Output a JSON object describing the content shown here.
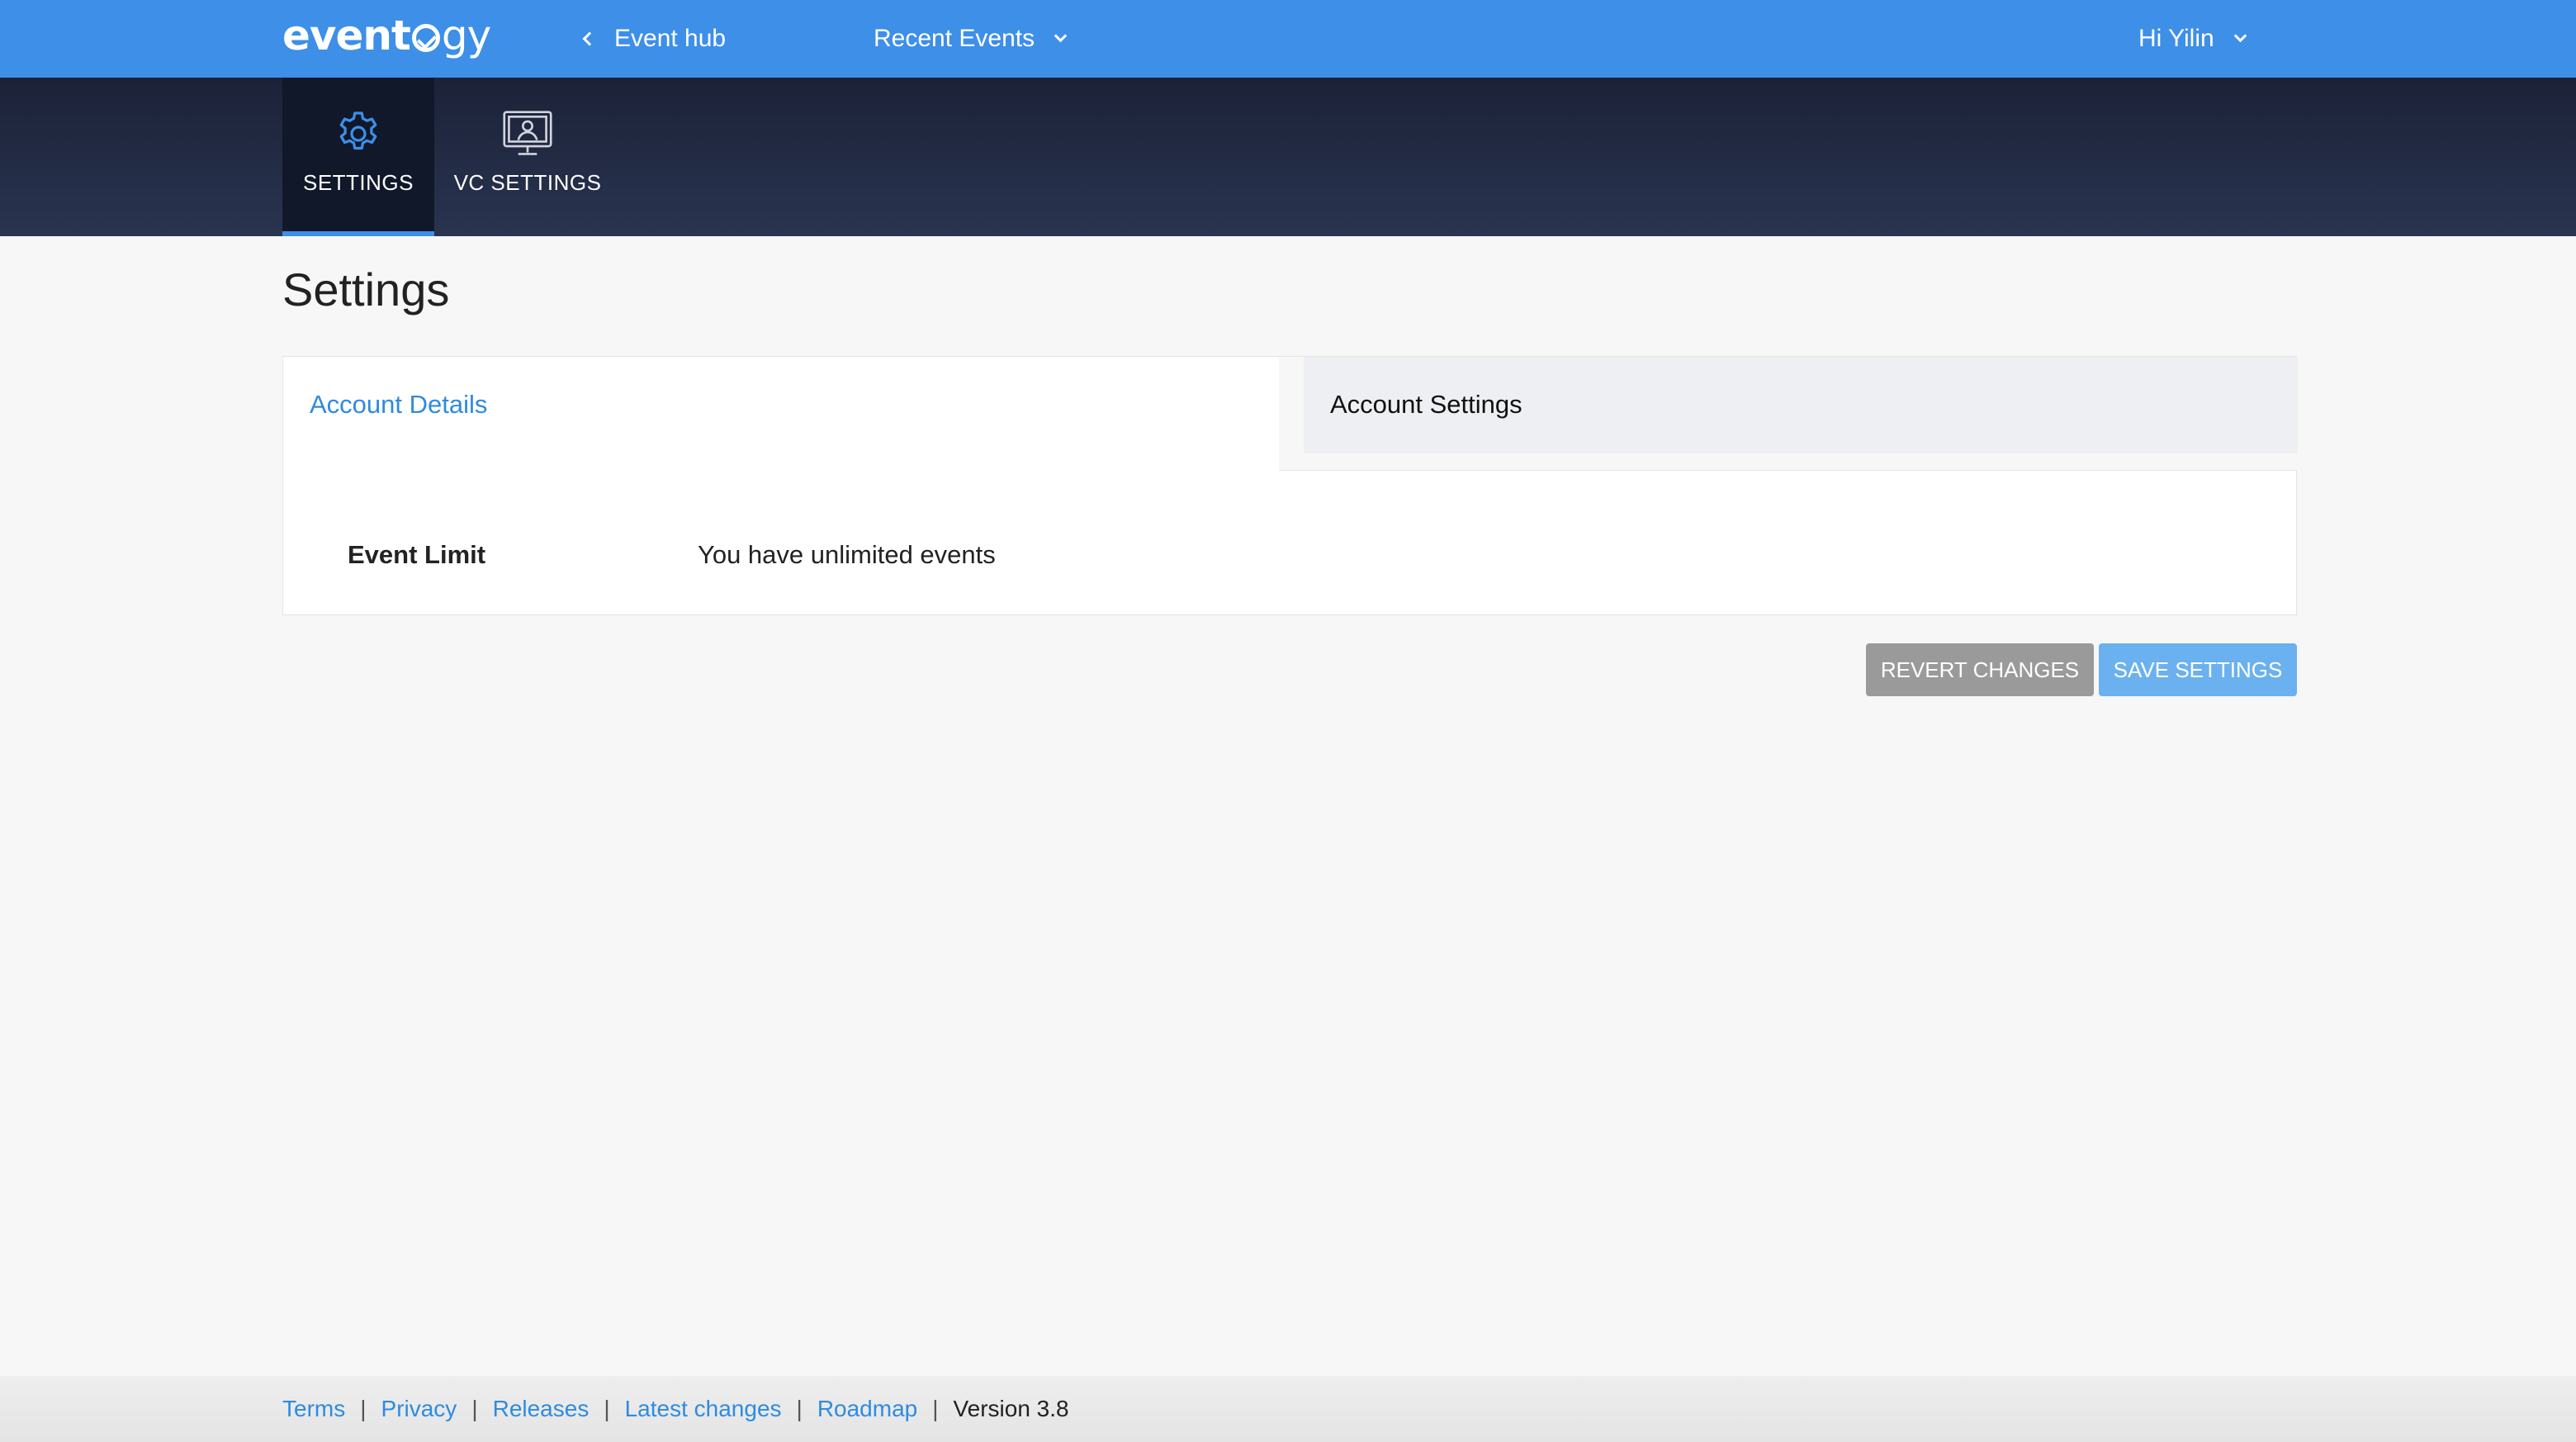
{
  "app": {
    "logo_text_a": "event",
    "logo_text_b": "gy"
  },
  "topbar": {
    "back_label": "Event hub",
    "recent_label": "Recent Events",
    "user_label": "Hi Yilin"
  },
  "tabs": [
    {
      "label": "SETTINGS",
      "icon": "gear-icon",
      "active": true
    },
    {
      "label": "VC SETTINGS",
      "icon": "monitor-user-icon",
      "active": false
    }
  ],
  "page": {
    "title": "Settings"
  },
  "card": {
    "tab_left": "Account Details",
    "tab_right": "Account Settings",
    "rows": [
      {
        "label": "Event Limit",
        "value": "You have unlimited events"
      }
    ]
  },
  "actions": {
    "revert_label": "REVERT CHANGES",
    "save_label": "SAVE SETTINGS"
  },
  "footer": {
    "links": [
      "Terms",
      "Privacy",
      "Releases",
      "Latest changes",
      "Roadmap"
    ],
    "separator": "|",
    "version": "Version 3.8"
  },
  "colors": {
    "topbar": "#3d8fe8",
    "band": "#1b2238",
    "link": "#2f8bde",
    "revert_button": "#9a9a9a",
    "save_button": "#6bb1ef"
  }
}
